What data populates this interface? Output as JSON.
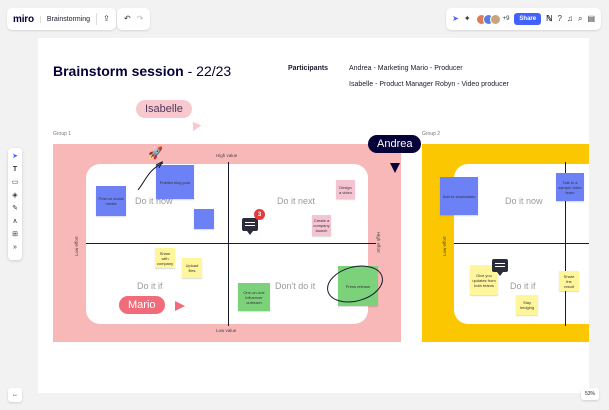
{
  "topbar": {
    "logo": "miro",
    "board_name": "Brainstorming",
    "avatar_count": "+9",
    "share_label": "Share",
    "icons": [
      "upload-icon",
      "undo-icon",
      "redo-icon",
      "cursor-icon",
      "reactions-icon",
      "timer-icon",
      "help-icon",
      "bell-icon",
      "search-icon",
      "notes-icon"
    ],
    "avatar_colors": [
      "#e07b5a",
      "#5a7be0",
      "#c9a37b"
    ]
  },
  "left_toolbar": {
    "tools": [
      "select-icon",
      "text-icon",
      "sticky-note-icon",
      "shapes-icon",
      "pen-icon",
      "connector-icon",
      "frame-icon",
      "more-icon"
    ]
  },
  "board": {
    "title_bold": "Brainstorm session",
    "title_rest": " - 22/23",
    "participants_label": "Participants",
    "participants_row1": "Andrea - Marketing  Mario - Producer",
    "participants_row2": "Isabelle - Product Manager  Robyn - Video producer",
    "group1_label": "Group 1",
    "group2_label": "Group 2",
    "high_value": "High value",
    "low_value": "Low value",
    "low_effort": "Low effort",
    "high_effort": "High effort",
    "quadrants": {
      "do_it_now": "Do it now",
      "do_it_next": "Do it next",
      "do_it_if": "Do it if",
      "dont_do_it": "Don't do it",
      "g2_do_it_now": "Do it now",
      "g2_do_it_if": "Do it if"
    },
    "stickies": {
      "publish_blog": "Publish blog post",
      "social_media": "Post on social media",
      "press_release": "Press release",
      "influencer": "One-on-one influencer outreach",
      "add_to_showcases": "Add to showcases",
      "give_updates": "Give you updates from both teams",
      "tiny1": "Design a video",
      "tiny2": "Create a company launch",
      "tiny3": "Share with company",
      "tiny4": "Upload files",
      "tiny5": "Talk to a sample video team",
      "tiny6": "Stay hedging",
      "tiny7": "Share the result"
    },
    "comment_count": "3"
  },
  "collaborators": {
    "isabelle": "Isabelle",
    "andrea": "Andrea",
    "mario": "Mario"
  },
  "colors": {
    "accent": "#4262ff",
    "pink_frame": "#f8b8b8",
    "yellow_frame": "#fbc700",
    "mario_bubble": "#f26b7a",
    "andrea_bubble": "#050038"
  },
  "zoom": "53%"
}
